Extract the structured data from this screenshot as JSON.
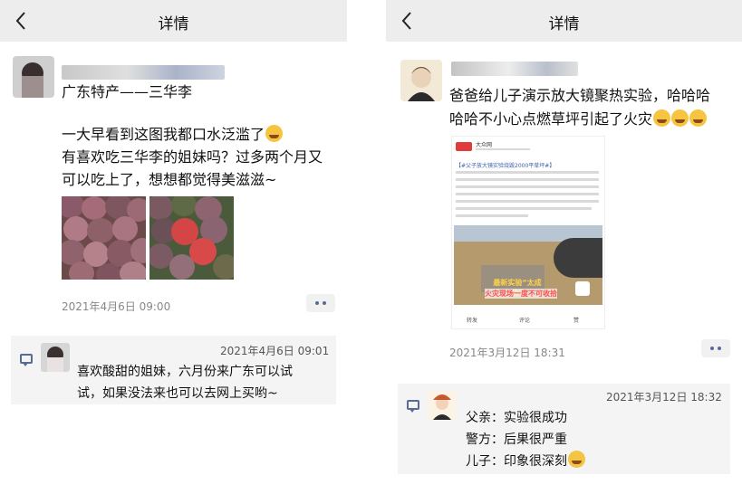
{
  "left": {
    "header": {
      "title": "详情"
    },
    "post": {
      "headline": "广东特产——三华李",
      "body_lines": [
        "一大早看到这图我都口水泛滥了",
        "有喜欢吃三华李的姐妹吗？过多两个月又",
        "可以吃上了，想想都觉得美滋滋~"
      ],
      "timestamp": "2021年4月6日 09:00"
    },
    "comment": {
      "time": "2021年4月6日 09:01",
      "lines": [
        "喜欢酸甜的姐妹，六月份来广东可以试",
        "试，如果没法来也可以去网上买哟~"
      ]
    }
  },
  "right": {
    "header": {
      "title": "详情"
    },
    "post": {
      "body_lines": [
        "爸爸给儿子演示放大镜聚热实验，哈哈哈",
        "哈哈不小心点燃草坪引起了火灾"
      ],
      "timestamp": "2021年3月12日 18:31",
      "news": {
        "source": "大众网",
        "hashtag": "【#父子放大镜实验烧毁2000平草坪#】",
        "caption_1": "最新实验“太成功”",
        "caption_2": "火灾现场一度不可收拾",
        "actions": [
          "转发",
          "评论",
          "赞"
        ]
      }
    },
    "comment": {
      "time": "2021年3月12日 18:32",
      "lines": [
        "父亲：实验很成功",
        "警方：后果很严重",
        "儿子：印象很深刻"
      ]
    }
  },
  "colors": {
    "link": "#576b95",
    "topbar": "#ededed",
    "comment_bg": "#f4f4f4"
  }
}
